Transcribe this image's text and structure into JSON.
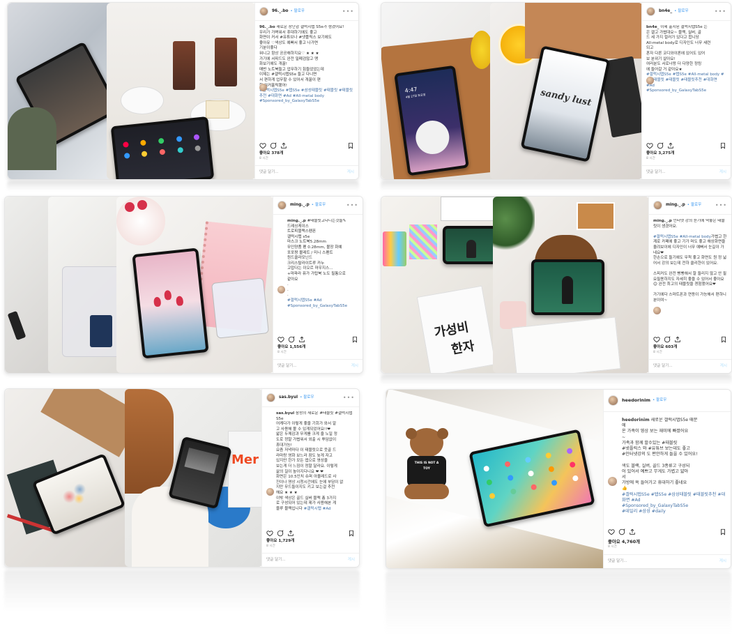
{
  "posts": [
    {
      "username": "96._.bo",
      "follow": "• 팔로우",
      "caption_user": "96._.bo",
      "caption": "새로운 장난감 갤럭시탭 S5e가 생겼어요!\n우리가 가벼워서 휴대하기에도 좋고\n화면이 커서 #유튜브나 #넷플릭스 보기에도\n좋아유 ♡색상도 예뻐서 좋고 나가면\n기분이좋다\n워니고 항상 공공해하지요♡ ★ ★ ★\n가기에 서피드도 완전 밀폐검않고 맹\n화보기에도 개꿀!\n매번 노트북들고 업무하기 힘들었었는데\n이제는 #갤럭시탭S5e 들고 다니면\n서 편하게 업무할 수 있어서 개꿀이 편\n한 워커홀릭됐어!\n",
      "tags": "#갤럭시탭S5e #탭S5e #삼성태블릿 #태블릿 #태블릿추천 #대화면 #Ad #All-metal body\n#Sponsored_by_GalaxyTabS5e",
      "likes": "좋아요 378개",
      "time": "8 시간",
      "comment": "댓글 달기...",
      "post": "게시"
    },
    {
      "username": "bn4e_",
      "follow": "• 팔로우",
      "caption_user": "bn4e_",
      "caption": "이제 출시된 갤럭시탭S5e 는 \n은 갤고 가볍대요~ 블랙, 실버, 골\n드 세 가지 컬러가 있다고 합니당\nAll-metal body로 디자인도 너무 세련\n되고\n혼자 다른 코디와이론에 있어도 있어\n보 분위기 살아요!\n여러분도 서로너랑 더 다양한 정링\n에 들어갈 거 같아요★\n",
      "tags": "#갤럭시탭S5e #탭S5e #All-metal body #삼성태블릿 #태블릿 #태블릿추천 #대화면\n#Ad\n#Sponsored_by_GalaxyTabS5e",
      "likes": "좋아요 3,275개",
      "time": "8 시간",
      "comment": "댓글 달기...",
      "post": "게시"
    },
    {
      "username": "ming._.p",
      "follow": "• 팔로우",
      "caption_user": "ming._.p",
      "caption": "#태블릿고다니는것들✎\n드레싱케이스\n트로피블랙스펜폰\n갤럭시탭 s5e\n마스크 노트북5.28mm\n무인양품 펜 0.28mm, 볼장 화예\n포포짱 볼레트 / 미니 스펜트\n원드클라모닌드\n크리스탈라이트루 카누\n고맙다는 이오르 마우지스...\n+마파라 퓨가 가탑북 노도 필통으로\n같아요\n.\n.\n.\n",
      "tags": "#갤럭시탭S5e #Ad\n#Sponsored_by_GalaxyTabS5e",
      "likes": "좋아요 1,556개",
      "time": "8 시간",
      "comment": "댓글 달기...",
      "post": "게시"
    },
    {
      "username": "ming._.p",
      "follow": "• 팔로우",
      "caption_user": "ming._.p",
      "caption": "인터넷 강의 듣기에 딱좋은 태블릿이 생겼어요.\n\n",
      "tags": "#갤럭시탭S5e #All-metal body",
      "caption2": "가볍고 한계로 카페에 좋고 기가 머도 좋고 해상화면을 올려보이에 디자인이 너무 예뻐서 눈길이 가네요❤\n한손으로 들기에도 무척 좋고 화면도 원 정 넓어서 강의 보는데 전하 클리한이 있어요.\n\n스피커도 완전 빵빵해서 잘 들리지 않고 안 필요필용하지도 자세히 좋을 수 있어서 좋아요😊 완전 최고의 태블릿을 경험했어요❤\n\n가기에다 스마트폰과 연동이 가능해서 편하니 분이여~",
      "likes": "좋아요 603개",
      "time": "8 시간",
      "comment": "댓글 달기...",
      "post": "게시"
    },
    {
      "username": "sas.byul",
      "follow": "• 팔로우",
      "caption_user": "sas.byul",
      "caption": "삼성의 새로운 #태블릿 #갤럭시탭S5e\n어케다가 이렇게 좋을 기회가 와서 알\n고 사용해 볼 수 있게되었어요!!❤\n얇은 두께감과 무게를 크게 줄 노일 정\n도로 정말 가볍워서 외출 시 뿌담없이\n휴대가능!\n요즘 저녁마다 이 태블릿으로 웃골 드\n라마랑 영화 보느라 잠도 늦게 자고\n있지만 한가 모든 앱으로 영상을\n보는게 더 느낌이 정말 달라요. 이렇게\n삶의 질이 높아지다니요 ❤ ❤\n화면은 10.5인치 슈퍼 아몰레드로 사\n진이나 영상 시청시간에도 눈에 부담이 없\n지만 무드들이지도 키고 보는걸 추천\n해요 ★ ★ ★\n이밖 색상은 골드 실버 블랙 총 3가지\n로 구성되어 있는데 제가 사용해본 게 \n블루 블랙입니다",
      "tags": "#갤럭시탭 #Ad",
      "likes": "좋아요 1,729개",
      "time": "8 시간",
      "comment": "댓글 달기...",
      "post": "게시"
    },
    {
      "username": "heedorinim",
      "follow": "• 팔로우",
      "caption_user": "heedorinim",
      "caption": "새로운 갤럭시탭S5e 때문\n에\n온 가족이 영상 보는 재미에 빠졌어요\n~\n가족과 함께 할수있는 #태블릿\n#넷플릭스 와 #유튜브 보는데도 좋고\n#인터넷강의 도 편안하게 들을 수 있어요!\n\n색도 블랙, 실버, 골드 3종류고 구성되\n어 있어서 예쁘고 무게도 가볍고 얇아\n서\n가방에 쏙 들어가고 휴대하기 좋네요\n👍\n",
      "tags": "#갤럭시탭S5e #탭S5e #삼성태블릿 #태블릿추천 #대화면 #Ad\n#Sponsored_by_GalaxyTabS5e\n#데일리 #삼성 #daily",
      "likes": "좋아요 4,760개",
      "time": "8 시간",
      "comment": "댓글 달기...",
      "post": "게시"
    }
  ],
  "photo_text": {
    "sandy_lust": "sandy lust",
    "big_value": "가성비",
    "hanja": "한자",
    "merry": "Mer",
    "bear_shirt_1": "THIS IS NOT A",
    "bear_shirt_2": "TOY",
    "tablet_time_1": "4:47",
    "tablet_time_2": "4월 27일 토요일"
  },
  "colors": {
    "link": "#3897f0",
    "hashtag": "#3f6ea5",
    "border": "#e6e6e6",
    "text": "#262626",
    "muted": "#999999"
  },
  "icons": [
    "heart-icon",
    "comment-icon",
    "share-icon",
    "bookmark-icon",
    "more-icon"
  ]
}
